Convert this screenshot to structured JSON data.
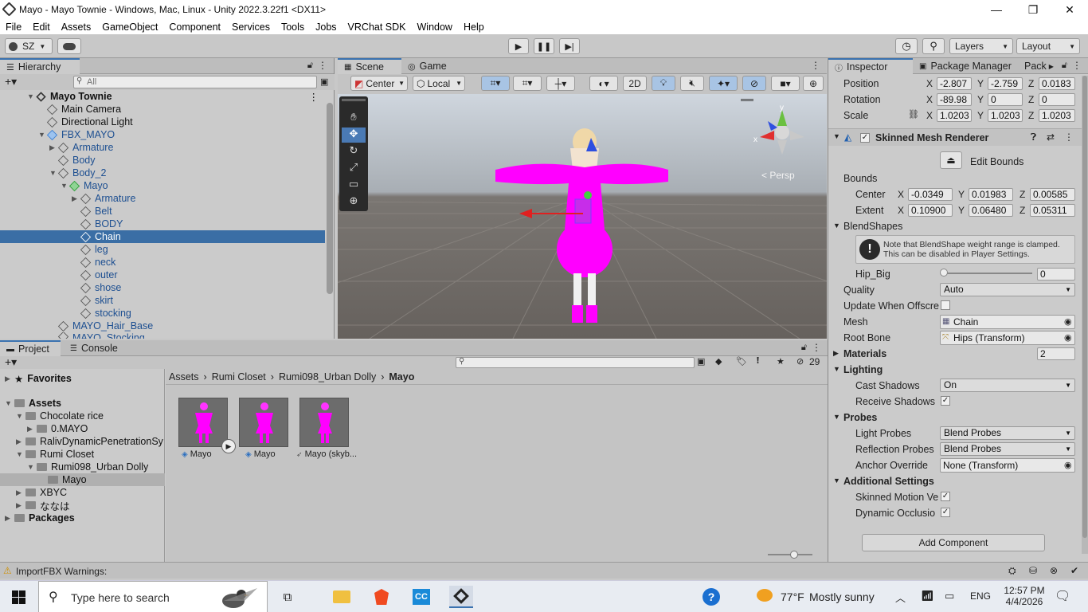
{
  "window": {
    "title": "Mayo - Mayo Townie - Windows, Mac, Linux - Unity 2022.3.22f1 <DX11>",
    "minimize": "—",
    "restore": "❐",
    "close": "✕"
  },
  "menu": [
    "File",
    "Edit",
    "Assets",
    "GameObject",
    "Component",
    "Services",
    "Tools",
    "Jobs",
    "VRChat SDK",
    "Window",
    "Help"
  ],
  "toolbar": {
    "account": "SZ",
    "layers": "Layers",
    "layout": "Layout"
  },
  "hierarchy": {
    "tab": "Hierarchy",
    "search_placeholder": "All",
    "scene_name": "Mayo Townie",
    "rows": [
      {
        "label": "Main Camera"
      },
      {
        "label": "Directional Light"
      },
      {
        "label": "FBX_MAYO"
      },
      {
        "label": "Armature"
      },
      {
        "label": "Body"
      },
      {
        "label": "Body_2"
      },
      {
        "label": "Mayo"
      },
      {
        "label": "Armature"
      },
      {
        "label": "Belt"
      },
      {
        "label": "BODY"
      },
      {
        "label": "Chain"
      },
      {
        "label": "leg"
      },
      {
        "label": "neck"
      },
      {
        "label": "outer"
      },
      {
        "label": "shose"
      },
      {
        "label": "skirt"
      },
      {
        "label": "stocking"
      },
      {
        "label": "MAYO_Hair_Base"
      },
      {
        "label": "MAYO_Stocking"
      }
    ]
  },
  "scene_view": {
    "tab_scene": "Scene",
    "tab_game": "Game",
    "pivot": "Center",
    "space": "Local",
    "mode_2d": "2D",
    "persp": "< Persp"
  },
  "inspector": {
    "tab_inspector": "Inspector",
    "tab_package": "Package Manager",
    "tab_more": "Pack",
    "position": {
      "label": "Position",
      "x": "-2.807",
      "y": "-2.759",
      "z": "0.0183"
    },
    "rotation": {
      "label": "Rotation",
      "x": "-89.98",
      "y": "0",
      "z": "0"
    },
    "scale": {
      "label": "Scale",
      "x": "1.0203",
      "y": "1.0203",
      "z": "1.0203"
    },
    "component": "Skinned Mesh Renderer",
    "edit_bounds": "Edit Bounds",
    "bounds": "Bounds",
    "center": {
      "label": "Center",
      "x": "-0.0349",
      "y": "0.01983",
      "z": "0.00585"
    },
    "extent": {
      "label": "Extent",
      "x": "0.10900",
      "y": "0.06480",
      "z": "0.05311"
    },
    "blendshapes": "BlendShapes",
    "blend_note": "Note that BlendShape weight range is clamped. This can be disabled in Player Settings.",
    "hip_big": {
      "label": "Hip_Big",
      "value": "0"
    },
    "quality": {
      "label": "Quality",
      "value": "Auto"
    },
    "update_offscreen": "Update When Offscre",
    "mesh": {
      "label": "Mesh",
      "value": "Chain"
    },
    "root_bone": {
      "label": "Root Bone",
      "value": "Hips (Transform)"
    },
    "materials": {
      "label": "Materials",
      "value": "2"
    },
    "lighting": "Lighting",
    "cast_shadows": {
      "label": "Cast Shadows",
      "value": "On"
    },
    "receive_shadows": "Receive Shadows",
    "probes": "Probes",
    "light_probes": {
      "label": "Light Probes",
      "value": "Blend Probes"
    },
    "reflection_probes": {
      "label": "Reflection Probes",
      "value": "Blend Probes"
    },
    "anchor_override": {
      "label": "Anchor Override",
      "value": "None (Transform)"
    },
    "additional": "Additional Settings",
    "skinned_motion": "Skinned Motion Ve",
    "dynamic_occlusion": "Dynamic Occlusio",
    "add_component": "Add Component"
  },
  "project": {
    "tab_project": "Project",
    "tab_console": "Console",
    "favorites": "Favorites",
    "assets": "Assets",
    "tree": [
      "Chocolate rice",
      "0.MAYO",
      "RalivDynamicPenetrationSy",
      "Rumi Closet",
      "Rumi098_Urban Dolly",
      "Mayo",
      "XBYC",
      "ななは",
      "Packages"
    ],
    "breadcrumb": [
      "Assets",
      "Rumi Closet",
      "Rumi098_Urban Dolly",
      "Mayo"
    ],
    "hidden_count": "29",
    "items": [
      {
        "label": "Mayo"
      },
      {
        "label": "Mayo"
      },
      {
        "label": "Mayo (skyb..."
      }
    ]
  },
  "status": {
    "message": "ImportFBX Warnings:"
  },
  "taskbar": {
    "search_placeholder": "Type here to search",
    "weather_temp": "77°F",
    "weather_text": "Mostly sunny",
    "lang": "ENG",
    "time": "12:57 PM",
    "date": "4/4/2026"
  }
}
